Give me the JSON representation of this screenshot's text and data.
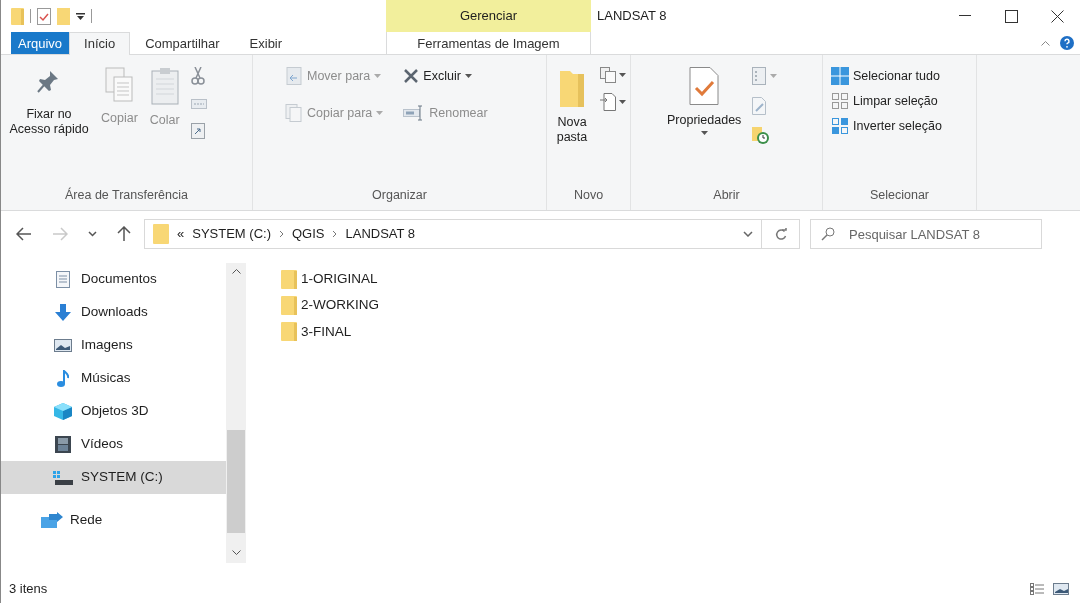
{
  "window": {
    "title": "LANDSAT 8"
  },
  "context_tab_group": {
    "title": "Gerenciar"
  },
  "tabs": [
    {
      "label": "Arquivo",
      "kind": "file",
      "selected": false
    },
    {
      "label": "Início",
      "kind": "normal",
      "selected": true
    },
    {
      "label": "Compartilhar",
      "kind": "normal",
      "selected": false
    },
    {
      "label": "Exibir",
      "kind": "normal",
      "selected": false
    },
    {
      "label": "Ferramentas de Imagem",
      "kind": "contextual",
      "selected": false
    }
  ],
  "ribbon": {
    "groups": [
      {
        "title": "Área de Transferência",
        "kind": "clipboard",
        "commands": [
          {
            "label": "Fixar no Acesso rápido",
            "disabled": false
          },
          {
            "label": "Copiar",
            "disabled": true
          },
          {
            "label": "Colar",
            "disabled": true
          }
        ]
      },
      {
        "title": "Organizar",
        "kind": "organize",
        "commands": [
          {
            "label": "Mover para",
            "disabled": true,
            "dropdown": true
          },
          {
            "label": "Copiar para",
            "disabled": true,
            "dropdown": true
          },
          {
            "label": "Excluir",
            "disabled": false,
            "dropdown": true
          },
          {
            "label": "Renomear",
            "disabled": true,
            "dropdown": false
          }
        ]
      },
      {
        "title": "Novo",
        "kind": "new",
        "commands": [
          {
            "label": "Nova pasta",
            "disabled": false,
            "dropdown": false
          }
        ]
      },
      {
        "title": "Abrir",
        "kind": "open",
        "commands": [
          {
            "label": "Propriedades",
            "disabled": false,
            "dropdown": true
          }
        ]
      },
      {
        "title": "Selecionar",
        "kind": "select",
        "commands": [
          {
            "label": "Selecionar tudo",
            "disabled": false
          },
          {
            "label": "Limpar seleção",
            "disabled": false
          },
          {
            "label": "Inverter seleção",
            "disabled": false
          }
        ]
      }
    ]
  },
  "nav_buttons": [
    {
      "kind": "back",
      "disabled": false
    },
    {
      "kind": "forward",
      "disabled": true
    },
    {
      "kind": "recent",
      "disabled": false
    },
    {
      "kind": "up",
      "disabled": false
    }
  ],
  "address_bar": {
    "overflow": "«",
    "path": [
      "SYSTEM (C:)",
      "QGIS",
      "LANDSAT 8"
    ]
  },
  "search": {
    "placeholder": "Pesquisar LANDSAT 8"
  },
  "navigation": {
    "items": [
      {
        "label": "Documentos",
        "kind": "documents",
        "selected": false
      },
      {
        "label": "Downloads",
        "kind": "downloads",
        "selected": false
      },
      {
        "label": "Imagens",
        "kind": "pictures",
        "selected": false
      },
      {
        "label": "Músicas",
        "kind": "music",
        "selected": false
      },
      {
        "label": "Objetos 3D",
        "kind": "objects3d",
        "selected": false
      },
      {
        "label": "Vídeos",
        "kind": "videos",
        "selected": false
      },
      {
        "label": "SYSTEM (C:)",
        "kind": "drive",
        "selected": true
      },
      {
        "label": "Rede",
        "kind": "network",
        "selected": false
      }
    ]
  },
  "files": [
    {
      "name": "1-ORIGINAL"
    },
    {
      "name": "2-WORKING"
    },
    {
      "name": "3-FINAL"
    }
  ],
  "status_bar": {
    "item_count": "3 itens"
  }
}
